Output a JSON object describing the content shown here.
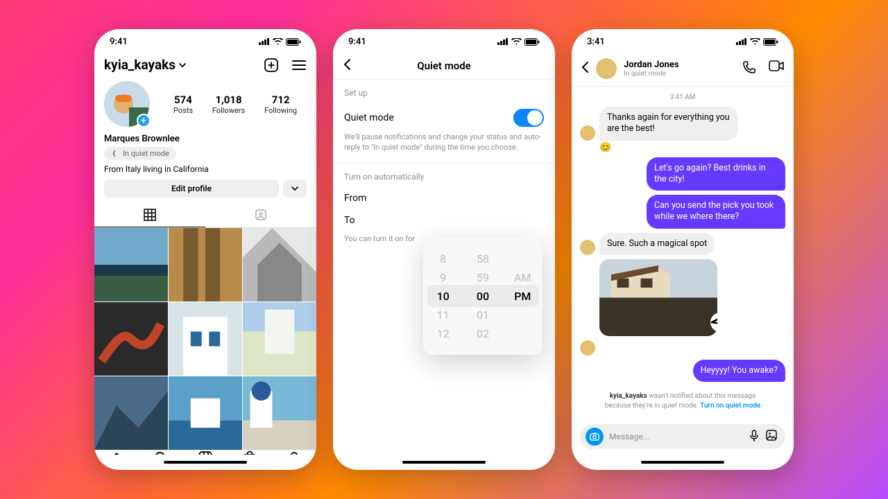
{
  "bg_colors": [
    "#ff3b77",
    "#ff2e9b",
    "#ff8a00",
    "#b84bff"
  ],
  "phone1": {
    "status_time": "9:41",
    "username": "kyia_kayaks",
    "stats": {
      "posts": {
        "n": "574",
        "l": "Posts"
      },
      "followers": {
        "n": "1,018",
        "l": "Followers"
      },
      "following": {
        "n": "712",
        "l": "Following"
      }
    },
    "display_name": "Marques Brownlee",
    "quiet_label": "In quiet mode",
    "bio": "From Italy living in California",
    "edit_label": "Edit profile",
    "nav": [
      "home",
      "search",
      "reels",
      "shop",
      "profile"
    ]
  },
  "phone2": {
    "status_time": "9:41",
    "title": "Quiet mode",
    "section_setup": "Set up",
    "row_quiet": "Quiet mode",
    "toggle_on": true,
    "desc": "We'll pause notifications and change your status and auto-reply to \"In quiet mode\" during the time you choose.",
    "section_auto": "Turn on automatically",
    "row_from": "From",
    "row_to": "To",
    "hint": "You can turn it on for",
    "picker": {
      "hour": [
        "8",
        "9",
        "10",
        "11",
        "12"
      ],
      "minute": [
        "58",
        "59",
        "00",
        "01",
        "02"
      ],
      "ampm": [
        "AM",
        "PM"
      ]
    }
  },
  "phone3": {
    "status_time": "3:41",
    "contact": "Jordan Jones",
    "contact_status": "In quiet mode",
    "timestamp": "3:41 AM",
    "messages": {
      "m1": "Thanks again for everything you are the best!",
      "m2": "Let's go again? Best drinks in the city!",
      "m3": "Can you send the pick you took while we where there?",
      "m4": "Sure. Such a magical spot",
      "m5": "Heyyyy! You awake?"
    },
    "notice_user": "kyia_kayaks",
    "notice_text": " wasn't notified about this message because they're in quiet mode. ",
    "notice_link": "Turn on quiet mode",
    "composer_placeholder": "Message..."
  }
}
